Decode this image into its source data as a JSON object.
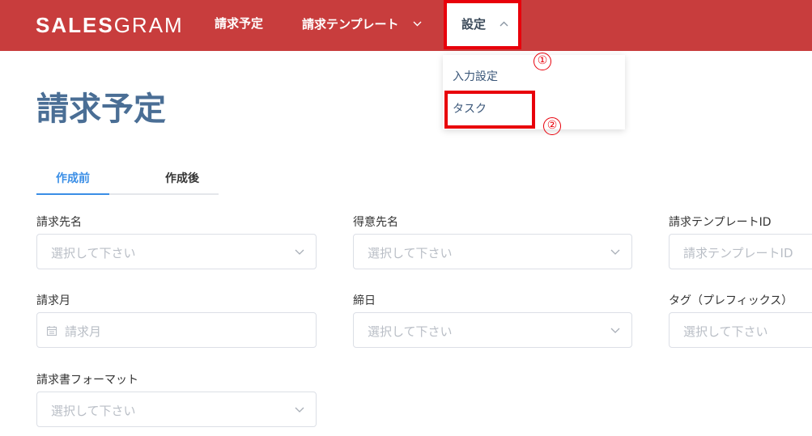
{
  "header": {
    "logo_bold": "SALES",
    "logo_light": "GRAM",
    "nav": {
      "billing_schedule": "請求予定",
      "billing_templates": "請求テンプレート",
      "settings": "設定"
    }
  },
  "dropdown": {
    "items": [
      "入力設定",
      "タスク"
    ]
  },
  "annotations": {
    "marker_1": "①",
    "marker_2": "②"
  },
  "page": {
    "title": "請求予定"
  },
  "tabs": [
    "作成前",
    "作成後"
  ],
  "form": {
    "billing_to": {
      "label": "請求先名",
      "placeholder": "選択して下さい"
    },
    "customer": {
      "label": "得意先名",
      "placeholder": "選択して下さい"
    },
    "template_id": {
      "label": "請求テンプレートID",
      "placeholder": "請求テンプレートID"
    },
    "billing_month": {
      "label": "請求月",
      "placeholder": "請求月"
    },
    "closing_day": {
      "label": "締日",
      "placeholder": "選択して下さい"
    },
    "tag": {
      "label": "タグ（プレフィックス）",
      "placeholder": "選択して下さい"
    },
    "invoice_format": {
      "label": "請求書フォーマット",
      "placeholder": "選択して下さい"
    }
  },
  "colors": {
    "header_bg": "#c83d3d",
    "highlight": "#e8000b",
    "title": "#4a6e95",
    "active_tab": "#3a8ee6"
  },
  "icons": [
    "chevron-down-icon",
    "chevron-up-icon",
    "calendar-icon"
  ]
}
